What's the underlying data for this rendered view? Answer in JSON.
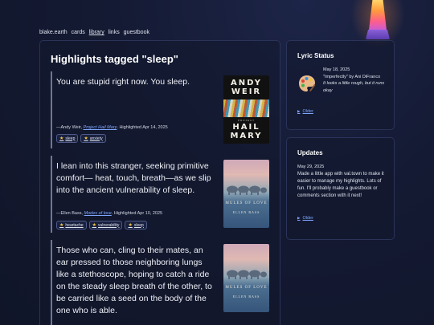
{
  "nav": {
    "items": [
      "blake.earth",
      "cards",
      "library",
      "links",
      "guestbook"
    ],
    "active": "library"
  },
  "main": {
    "title": "Highlights tagged \"sleep\"",
    "highlights": [
      {
        "quote": "You are stupid right now. You sleep.",
        "author": "—Andy Weir,",
        "book": "Project Hail Mary",
        "highlighted": ". Highlighted Apr 14, 2025",
        "tags": [
          "sleep",
          "anxiety"
        ],
        "cover": {
          "line1": "ANDY",
          "line2": "WEIR",
          "line3": "HAIL",
          "line4": "MARY",
          "small": "PROJECT"
        }
      },
      {
        "quote": "I lean into this stranger, seeking primitive comfort— heat, touch, breath—as we slip into the ancient vulnerability of sleep.",
        "author": "—Ellen Bass,",
        "book": "Modes of love",
        "highlighted": ". Highlighted Apr 10, 2025",
        "tags": [
          "heartache",
          "vulnerability",
          "sleep"
        ],
        "cover": {
          "title": "MULES OF LOVE",
          "author": "ELLEN BASS",
          "small": "POEMS"
        }
      },
      {
        "quote": "Those who can, cling to their mates, an ear pressed to those neighboring lungs like a stethoscope, hoping to catch a ride on the steady sleep breath of the other, to be carried like a seed on the body of the one who is able.",
        "author": "—Ellen Bass,",
        "book": "Mules of Love",
        "highlighted": ". Highlighted Apr 10, 2025",
        "tags": [],
        "cover": {
          "title": "MULES OF LOVE",
          "author": "ELLEN BASS",
          "small": "POEMS"
        }
      }
    ]
  },
  "lyric_status": {
    "title": "Lyric Status",
    "icon": "palette-icon",
    "date": "May 18, 2025",
    "song": "\"Imperfectly\" by Ani DiFranco",
    "note": "It looks a little rough, but it runs okay",
    "older": "Older"
  },
  "updates": {
    "title": "Updates",
    "date": "May 29, 2025",
    "text": "Made a little app with val.town to make it easier to manage my highlights. Lots of fun. I'll probably make a guestbook or comments section with it next!",
    "older": "Older"
  },
  "colors": {
    "background": "#141a33",
    "accent_link": "#7fa6ff",
    "tag_star": "#f5c642",
    "panel_border": "#2a3358"
  }
}
